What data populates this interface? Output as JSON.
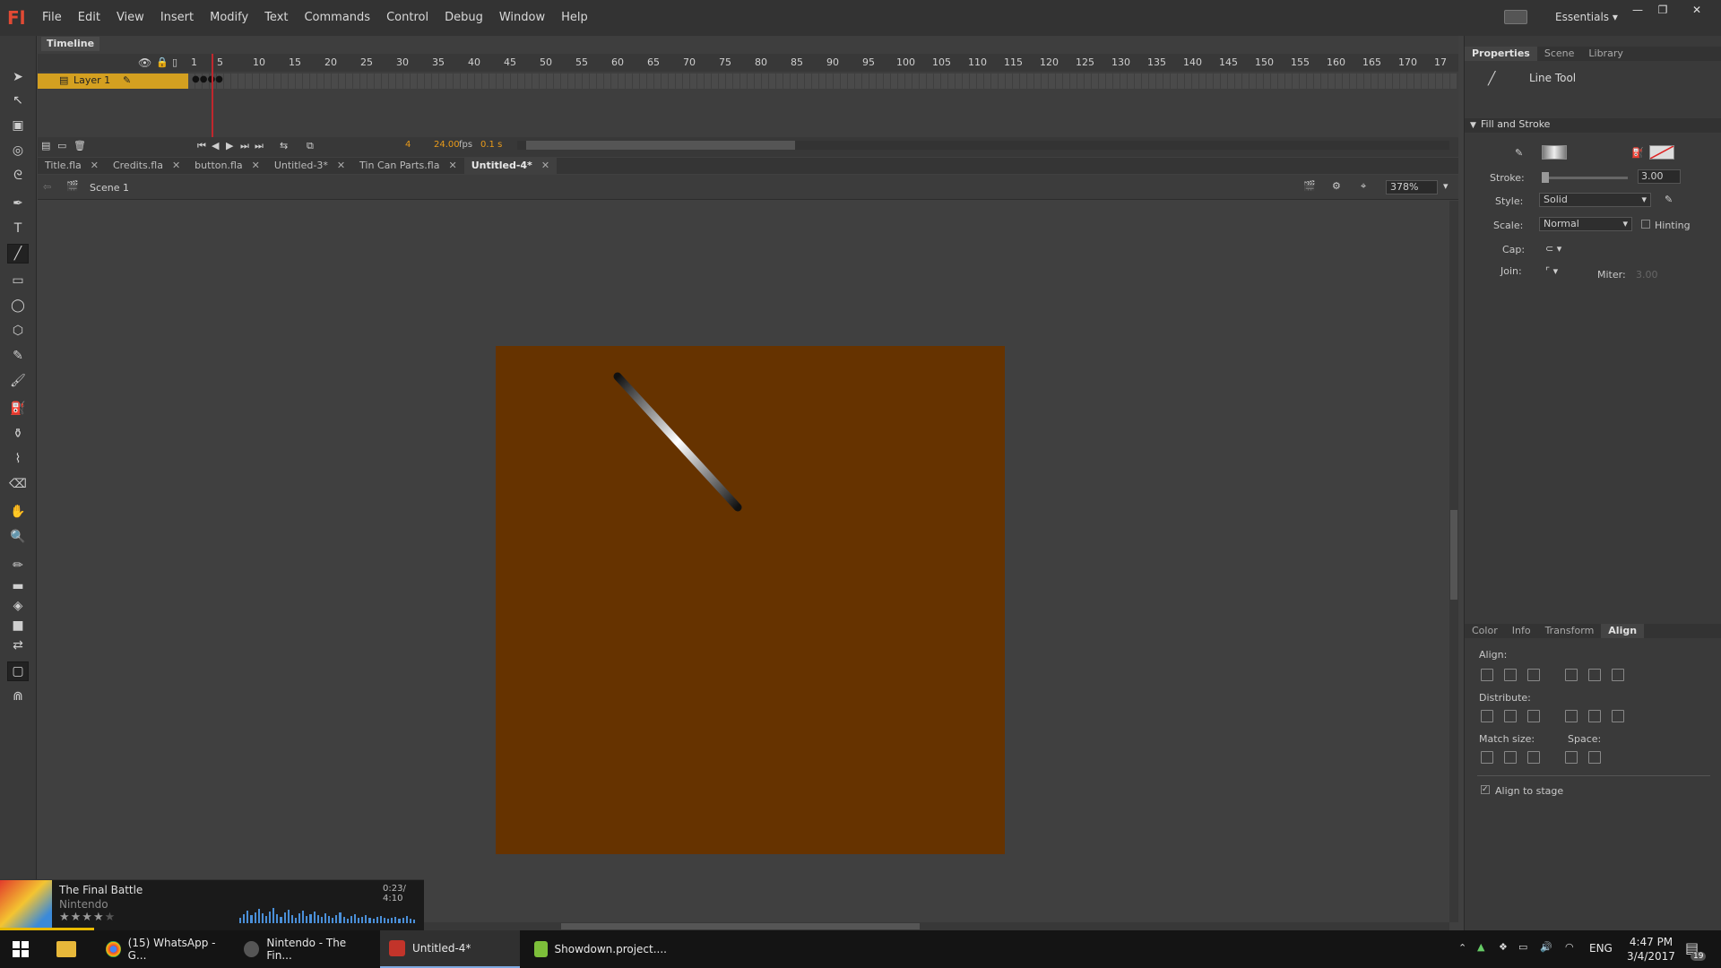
{
  "app": {
    "logo": "Fl"
  },
  "menu": [
    "File",
    "Edit",
    "View",
    "Insert",
    "Modify",
    "Text",
    "Commands",
    "Control",
    "Debug",
    "Window",
    "Help"
  ],
  "workspace": {
    "label": "Essentials"
  },
  "timeline": {
    "tab_label": "Timeline",
    "ruler": [
      "1",
      "5",
      "10",
      "15",
      "20",
      "25",
      "30",
      "35",
      "40",
      "45",
      "50",
      "55",
      "60",
      "65",
      "70",
      "75",
      "80",
      "85",
      "90",
      "95",
      "100",
      "105",
      "110",
      "115",
      "120",
      "125",
      "130",
      "135",
      "140",
      "145",
      "150",
      "155",
      "160",
      "165",
      "170",
      "17"
    ],
    "layer_name": "Layer 1",
    "current_frame": "4",
    "fps": "24.00",
    "fps_unit": "fps",
    "time": "0.1 s"
  },
  "doc_tabs": [
    {
      "label": "Title.fla",
      "active": false
    },
    {
      "label": "Credits.fla",
      "active": false
    },
    {
      "label": "button.fla",
      "active": false
    },
    {
      "label": "Untitled-3*",
      "active": false
    },
    {
      "label": "Tin Can Parts.fla",
      "active": false
    },
    {
      "label": "Untitled-4*",
      "active": true
    }
  ],
  "edit_bar": {
    "scene": "Scene 1",
    "zoom": "378%"
  },
  "stage": {
    "color": "#663300"
  },
  "right_panel": {
    "tabs": [
      "Properties",
      "Scene",
      "Library"
    ],
    "tool_name": "Line Tool",
    "section": "Fill and Stroke",
    "stroke_label": "Stroke:",
    "stroke_value": "3.00",
    "style_label": "Style:",
    "style_value": "Solid",
    "scale_label": "Scale:",
    "scale_value": "Normal",
    "hinting_label": "Hinting",
    "cap_label": "Cap:",
    "join_label": "Join:",
    "miter_label": "Miter:",
    "miter_value": "3.00"
  },
  "align_panel": {
    "tabs": [
      "Color",
      "Info",
      "Transform",
      "Align"
    ],
    "align_label": "Align:",
    "distribute_label": "Distribute:",
    "match_size_label": "Match size:",
    "space_label": "Space:",
    "align_to_stage_label": "Align to stage"
  },
  "media": {
    "title": "The Final Battle",
    "artist": "Nintendo",
    "time": "0:23/ 4:10",
    "rating": 4
  },
  "taskbar": {
    "items": [
      {
        "label": "(15) WhatsApp - G...",
        "active": false
      },
      {
        "label": "Nintendo - The Fin...",
        "active": false
      },
      {
        "label": "Untitled-4*",
        "active": true
      },
      {
        "label": "Showdown.project....",
        "active": false
      }
    ],
    "language": "ENG",
    "time": "4:47 PM",
    "date": "3/4/2017",
    "notifications": "19"
  }
}
